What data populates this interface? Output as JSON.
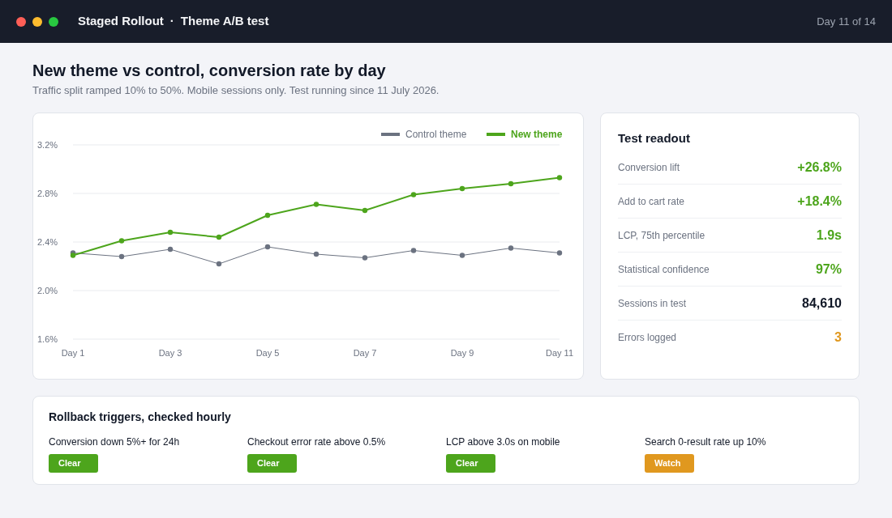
{
  "header": {
    "app": "Staged Rollout",
    "separator": "·",
    "page": "Theme A/B test",
    "day_text": "Day 11 of 14"
  },
  "intro": {
    "title": "New theme vs control, conversion rate by day",
    "description": "Traffic split ramped 10% to 50%. Mobile sessions only. Test running since 11 July 2026."
  },
  "chart": {
    "series_styles": [
      {
        "emphasized": false
      },
      {
        "emphasized": true
      }
    ],
    "chart_data": {
      "type": "line",
      "grid": true,
      "legend": true,
      "categories": [
        "Day 1",
        null,
        "Day 3",
        null,
        "Day 5",
        null,
        "Day 7",
        null,
        "Day 9",
        null,
        "Day 11"
      ],
      "ylim": [
        1.6,
        3.2
      ],
      "yticks": [
        {
          "value": 1.6,
          "label": "1.6%"
        },
        {
          "value": 2.0,
          "label": "2.0%"
        },
        {
          "value": 2.4,
          "label": "2.4%"
        },
        {
          "value": 2.8,
          "label": "2.8%"
        },
        {
          "value": 3.2,
          "label": "3.2%"
        }
      ],
      "series": [
        {
          "name": "Control theme",
          "color": "#6b7280",
          "marker": "circle",
          "values": [
            2.31,
            2.28,
            2.34,
            2.22,
            2.36,
            2.3,
            2.27,
            2.33,
            2.29,
            2.35,
            2.31
          ]
        },
        {
          "name": "New theme",
          "color": "#4da51c",
          "marker": "circle",
          "values": [
            2.29,
            2.41,
            2.48,
            2.44,
            2.62,
            2.71,
            2.66,
            2.79,
            2.84,
            2.88,
            2.93
          ]
        }
      ]
    }
  },
  "readout": {
    "title": "Test readout",
    "rows": [
      {
        "label": "Conversion lift",
        "value": "+26.8%",
        "color": "#4da51c"
      },
      {
        "label": "Add to cart rate",
        "value": "+18.4%",
        "color": "#4da51c"
      },
      {
        "label": "LCP, 75th percentile",
        "value": "1.9s",
        "color": "#4da51c"
      },
      {
        "label": "Statistical confidence",
        "value": "97%",
        "color": "#4da51c"
      },
      {
        "label": "Sessions in test",
        "value": "84,610",
        "color": "#111827"
      },
      {
        "label": "Errors logged",
        "value": "3",
        "color": "#e0981f"
      }
    ]
  },
  "triggers": {
    "title": "Rollback triggers, checked hourly",
    "items": [
      {
        "label": "Conversion down 5%+ for 24h",
        "status": "Clear",
        "color": "#4da51c"
      },
      {
        "label": "Checkout error rate above 0.5%",
        "status": "Clear",
        "color": "#4da51c"
      },
      {
        "label": "LCP above 3.0s on mobile",
        "status": "Clear",
        "color": "#4da51c"
      },
      {
        "label": "Search 0-result rate up 10%",
        "status": "Watch",
        "color": "#e0981f"
      }
    ]
  }
}
